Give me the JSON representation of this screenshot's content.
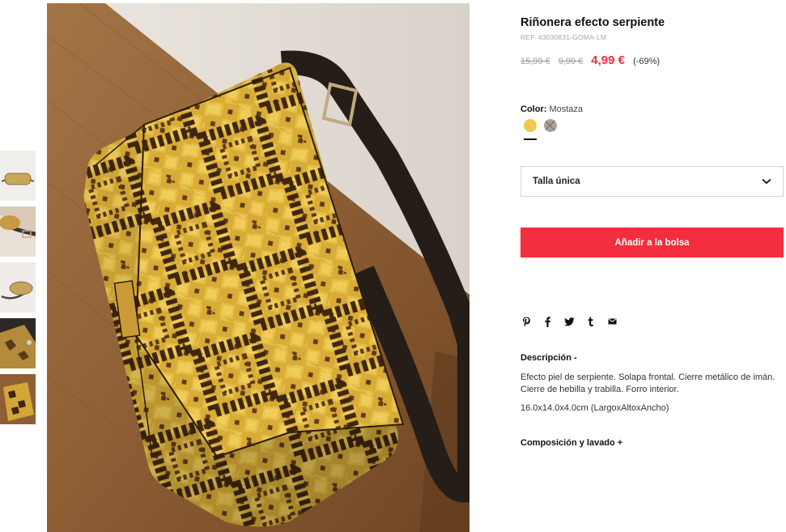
{
  "product": {
    "title": "Riñonera efecto serpiente",
    "ref": "REF. 43030831-GOMA-LM",
    "price_original_1": "15,99 €",
    "price_original_2": "9,99 €",
    "price_current": "4,99 €",
    "discount": "(-69%)"
  },
  "color": {
    "label": "Color:",
    "selected": "Mostaza",
    "swatches": [
      {
        "name": "mustard",
        "hex": "#f1c94e",
        "available": true,
        "selected": true
      },
      {
        "name": "grey",
        "hex": "#a9a199",
        "available": false,
        "selected": false
      }
    ]
  },
  "size": {
    "selected": "Talla única"
  },
  "actions": {
    "add_to_bag": "Añadir a la bolsa"
  },
  "share": {
    "icons": [
      "pinterest-icon",
      "facebook-icon",
      "twitter-icon",
      "tumblr-icon",
      "email-icon"
    ]
  },
  "description": {
    "title": "Descripción -",
    "text": "Efecto piel de serpiente. Solapa frontal. Cierre metálico de imán. Cierre de hebilla y trabilla. Forro interior.",
    "dimensions": "16.0x14.0x4.0cm (LargoxAltoxAncho)"
  },
  "composition": {
    "title": "Composición y lavado +"
  },
  "colors": {
    "accent": "#f22d3d",
    "price_red": "#e8323c"
  }
}
